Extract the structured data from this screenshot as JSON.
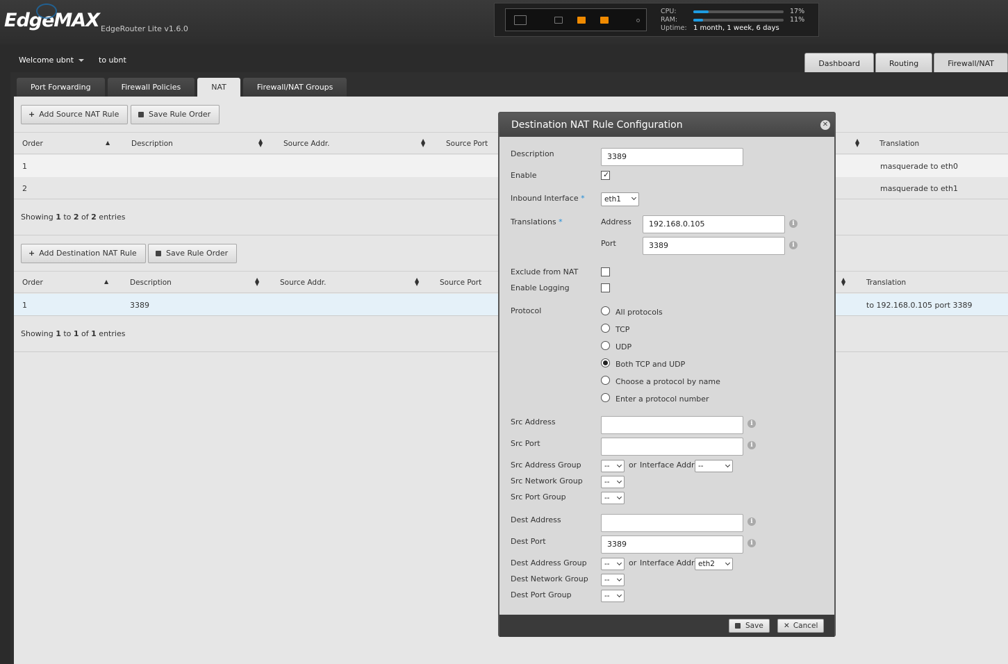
{
  "header": {
    "logo": "EdgeMAX",
    "device": "EdgeRouter Lite v1.6.0",
    "cpu_label": "CPU:",
    "cpu_value": "17%",
    "cpu_fraction": 0.17,
    "ram_label": "RAM:",
    "ram_value": "11%",
    "ram_fraction": 0.11,
    "uptime_label": "Uptime:",
    "uptime_value": "1 month, 1 week, 6 days",
    "accent": "#f08a00"
  },
  "subheader": {
    "welcome": "Welcome ubnt",
    "to_user": "to ubnt",
    "tabs": [
      "Dashboard",
      "Routing",
      "Firewall/NAT"
    ],
    "active_tab": "Firewall/NAT"
  },
  "subtabs": [
    "Port Forwarding",
    "Firewall Policies",
    "NAT",
    "Firewall/NAT Groups"
  ],
  "source_nat": {
    "add_button": "Add Source NAT Rule",
    "save_order_button": "Save Rule Order",
    "columns": [
      "Order",
      "Description",
      "Source Addr.",
      "Source Port",
      "Translation"
    ],
    "rows": [
      {
        "order": "1",
        "translation": "masquerade to eth0"
      },
      {
        "order": "2",
        "translation": "masquerade to eth1"
      }
    ],
    "showing": {
      "pre": "Showing ",
      "from": "1",
      "mid1": " to ",
      "to": "2",
      "mid2": " of ",
      "total": "2",
      "post": " entries"
    }
  },
  "dest_nat": {
    "add_button": "Add Destination NAT Rule",
    "save_order_button": "Save Rule Order",
    "columns": [
      "Order",
      "Description",
      "Source Addr.",
      "Source Port",
      "Translation"
    ],
    "rows": [
      {
        "order": "1",
        "description": "3389",
        "translation": "to 192.168.0.105 port 3389"
      }
    ],
    "showing": {
      "pre": "Showing ",
      "from": "1",
      "mid1": " to ",
      "to": "1",
      "mid2": " of ",
      "total": "1",
      "post": " entries"
    }
  },
  "modal": {
    "title": "Destination NAT Rule Configuration",
    "description_label": "Description",
    "description_value": "3389",
    "enable_label": "Enable",
    "enable_checked": true,
    "inbound_label": "Inbound Interface",
    "inbound_value": "eth1",
    "translations_label": "Translations",
    "address_label": "Address",
    "address_value": "192.168.0.105",
    "port_label": "Port",
    "port_value": "3389",
    "exclude_label": "Exclude from NAT",
    "logging_label": "Enable Logging",
    "protocol_label": "Protocol",
    "protocols": [
      "All protocols",
      "TCP",
      "UDP",
      "Both TCP and UDP",
      "Choose a protocol by name",
      "Enter a protocol number"
    ],
    "protocol_selected": "Both TCP and UDP",
    "src_address_label": "Src Address",
    "src_port_label": "Src Port",
    "src_address_group_label": "Src Address Group",
    "src_network_group_label": "Src Network Group",
    "src_port_group_label": "Src Port Group",
    "dest_address_label": "Dest Address",
    "dest_port_label": "Dest Port",
    "dest_port_value": "3389",
    "dest_address_group_label": "Dest Address Group",
    "dest_network_group_label": "Dest Network Group",
    "dest_port_group_label": "Dest Port Group",
    "or_text": "or",
    "interface_addr_label": "Interface Addr",
    "dash_option": "--",
    "src_interface_value": "--",
    "dest_interface_value": "eth2",
    "save_button": "Save",
    "cancel_button": "Cancel"
  }
}
